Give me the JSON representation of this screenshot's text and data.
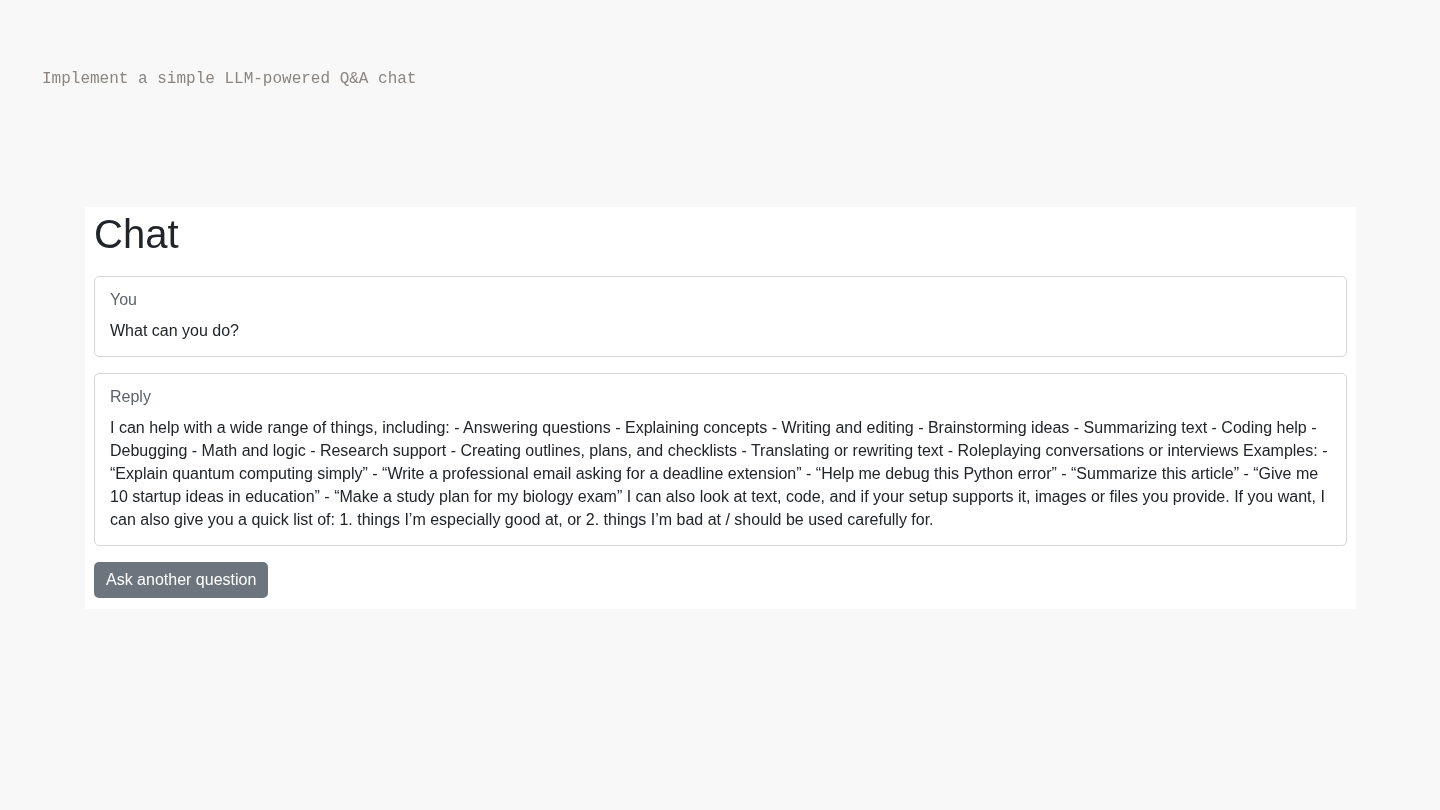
{
  "task": {
    "caption": "Implement a simple LLM-powered Q&A chat"
  },
  "chat": {
    "title": "Chat",
    "messages": [
      {
        "label": "You",
        "text": "What can you do?"
      },
      {
        "label": "Reply",
        "text": "I can help with a wide range of things, including: - Answering questions - Explaining concepts - Writing and editing - Brainstorming ideas - Summarizing text - Coding help - Debugging - Math and logic - Research support - Creating outlines, plans, and checklists - Translating or rewriting text - Roleplaying conversations or interviews Examples: - “Explain quantum computing simply” - “Write a professional email asking for a deadline extension” - “Help me debug this Python error” - “Summarize this article” - “Give me 10 startup ideas in education” - “Make a study plan for my biology exam” I can also look at text, code, and if your setup supports it, images or files you provide. If you want, I can also give you a quick list of: 1. things I’m especially good at, or 2. things I’m bad at / should be used carefully for."
      }
    ],
    "button": "Ask another question"
  }
}
